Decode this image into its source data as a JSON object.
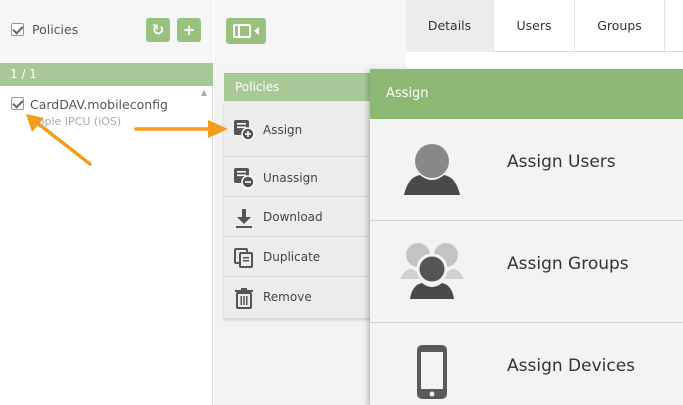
{
  "left_panel": {
    "header_title": "Policies",
    "count": "1 / 1",
    "items": [
      {
        "name": "CardDAV.mobileconfig",
        "subtitle": "Apple IPCU (iOS)",
        "checked": true
      }
    ]
  },
  "menu": {
    "title": "Policies",
    "items": [
      {
        "label": "Assign",
        "icon": "assign-icon"
      },
      {
        "label": "Unassign",
        "icon": "unassign-icon"
      },
      {
        "label": "Download",
        "icon": "download-icon"
      },
      {
        "label": "Duplicate",
        "icon": "duplicate-icon"
      },
      {
        "label": "Remove",
        "icon": "trash-icon"
      }
    ]
  },
  "tabs": [
    {
      "label": "Details",
      "active": true
    },
    {
      "label": "Users",
      "active": false
    },
    {
      "label": "Groups",
      "active": false
    }
  ],
  "assign_panel": {
    "title": "Assign",
    "options": [
      {
        "label": "Assign Users",
        "icon": "user-icon"
      },
      {
        "label": "Assign Groups",
        "icon": "group-icon"
      },
      {
        "label": "Assign Devices",
        "icon": "phone-icon"
      }
    ]
  },
  "colors": {
    "accent_green": "#99c07d",
    "header_green": "#8db874",
    "annotation_orange": "#f39c1e"
  }
}
